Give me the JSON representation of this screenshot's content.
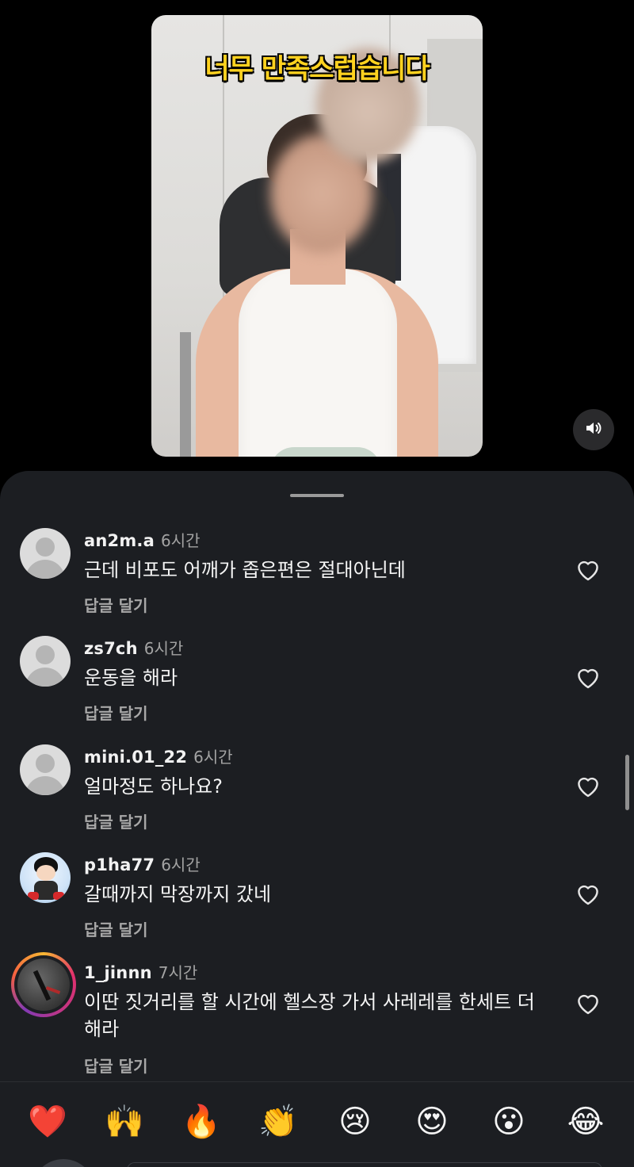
{
  "video": {
    "caption": "너무 만족스럽습니다",
    "mute_icon": "speaker-icon"
  },
  "colors": {
    "sheet_background": "#1c1e22",
    "caption_yellow": "#ffd21f",
    "secondary_text": "#a3a3a3"
  },
  "comments": [
    {
      "username": "an2m.a",
      "time": "6시간",
      "text": "근데 비포도 어깨가 좁은편은 절대아닌데",
      "reply": "답글 달기",
      "avatar": "default-avatar"
    },
    {
      "username": "zs7ch",
      "time": "6시간",
      "text": "운동을 해라",
      "reply": "답글 달기",
      "avatar": "default-avatar"
    },
    {
      "username": "mini.01_22",
      "time": "6시간",
      "text": "얼마정도 하나요?",
      "reply": "답글 달기",
      "avatar": "default-avatar"
    },
    {
      "username": "p1ha77",
      "time": "6시간",
      "text": "갈때까지 막장까지 갔네",
      "reply": "답글 달기",
      "avatar": "astro-boy-avatar"
    },
    {
      "username": "1_jinnn",
      "time": "7시간",
      "text": "이딴 짓거리를 할 시간에 헬스장 가서 사레레를 한세트 더 해라",
      "reply": "답글 달기",
      "avatar": "story-ring-avatar"
    }
  ],
  "emoji_bar": [
    "❤️",
    "🙌",
    "🔥",
    "👏",
    "😢",
    "😍",
    "😮",
    "😂"
  ]
}
